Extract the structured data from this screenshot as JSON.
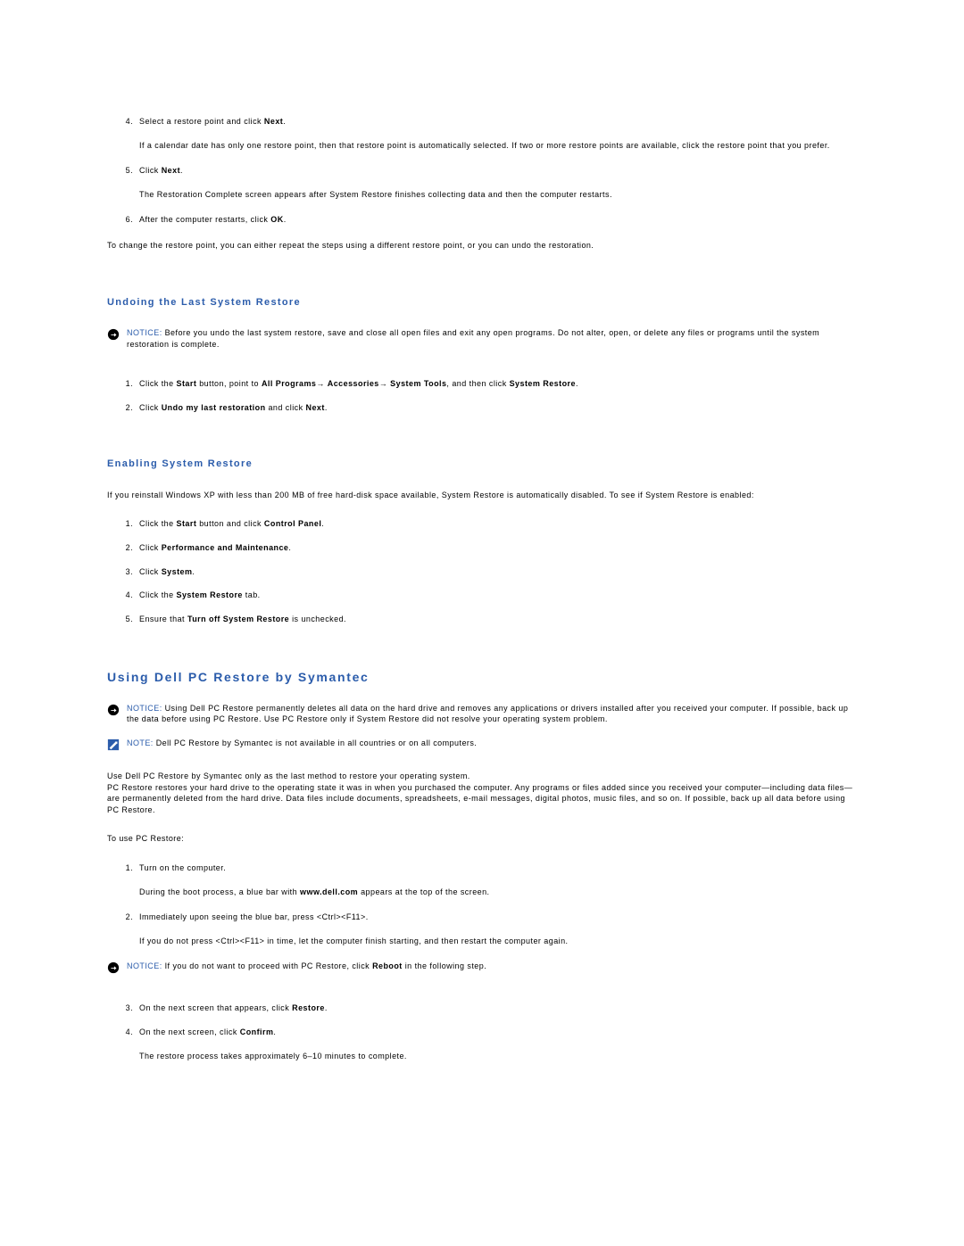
{
  "steps_a": [
    {
      "prefix": "Select a restore point and click ",
      "bold1": "Next",
      "after1": ".",
      "sub": "If a calendar date has only one restore point, then that restore point is automatically selected. If two or more restore points are available, click the restore point that you prefer."
    },
    {
      "prefix": "Click ",
      "bold1": "Next",
      "after1": ".",
      "sub": "The Restoration Complete screen appears after System Restore finishes collecting data and then the computer restarts."
    },
    {
      "prefix": "After the computer restarts, click ",
      "bold1": "OK",
      "after1": "."
    }
  ],
  "para_change": "To change the restore point, you can either repeat the steps using a different restore point, or you can undo the restoration.",
  "subhead_undo": "Undoing the Last System Restore",
  "notice_undo": {
    "label": "NOTICE: ",
    "text": "Before you undo the last system restore, save and close all open files and exit any open programs. Do not alter, open, or delete any files or programs until the system restoration is complete."
  },
  "steps_undo": [
    {
      "p1": "Click the ",
      "b1": "Start",
      "p2": " button, point to ",
      "b2": "All Programs",
      "arr1": "→ ",
      "b3": "Accessories",
      "arr2": "→ ",
      "b4": "System Tools",
      "p3": ", and then click ",
      "b5": "System Restore",
      "p4": "."
    },
    {
      "p1": "Click ",
      "b1": "Undo my last restoration",
      "p2": " and click ",
      "b2": "Next",
      "p3": "."
    }
  ],
  "subhead_enable": "Enabling System Restore",
  "para_enable": "If you reinstall Windows XP with less than 200 MB of free hard-disk space available, System Restore is automatically disabled. To see if System Restore is enabled:",
  "steps_enable": [
    {
      "p1": "Click the ",
      "b1": "Start",
      "p2": " button and click ",
      "b2": "Control Panel",
      "p3": "."
    },
    {
      "p1": "Click ",
      "b1": "Performance and Maintenance",
      "p2": "."
    },
    {
      "p1": "Click ",
      "b1": "System",
      "p2": "."
    },
    {
      "p1": "Click the ",
      "b1": "System Restore",
      "p2": " tab."
    },
    {
      "p1": "Ensure that ",
      "b1": "Turn off System Restore",
      "p2": " is unchecked."
    }
  ],
  "heading_dell": "Using Dell PC Restore by Symantec",
  "notice_dell": {
    "label": "NOTICE: ",
    "text": "Using Dell PC Restore permanently deletes all data on the hard drive and removes any applications or drivers installed after you received your computer. If possible, back up the data before using PC Restore. Use PC Restore only if System Restore did not resolve your operating system problem."
  },
  "note_dell": {
    "label": "NOTE: ",
    "text": "Dell PC Restore by Symantec is not available in all countries or on all computers."
  },
  "para_dell1": "Use Dell PC Restore by Symantec only as the last method to restore your operating system.",
  "para_dell2": "PC Restore restores your hard drive to the operating state it was in when you purchased the computer. Any programs or files added since you received your computer—including data files—are permanently deleted from the hard drive. Data files include documents, spreadsheets, e-mail messages, digital photos, music files, and so on. If possible, back up all data before using PC Restore.",
  "para_dell3": "To use PC Restore:",
  "steps_dell_a": [
    {
      "p1": "Turn on the computer.",
      "sub_pre": "During the boot process, a blue bar with ",
      "sub_b": "www.dell.com",
      "sub_post": " appears at the top of the screen."
    },
    {
      "p1": "Immediately upon seeing the blue bar, press <Ctrl><F11>.",
      "sub": "If you do not press <Ctrl><F11> in time, let the computer finish starting, and then restart the computer again."
    }
  ],
  "notice_reboot": {
    "label": "NOTICE: ",
    "p1": "If you do not want to proceed with PC Restore, click ",
    "b1": "Reboot",
    "p2": " in the following step."
  },
  "steps_dell_b": [
    {
      "p1": "On the next screen that appears, click ",
      "b1": "Restore",
      "p2": "."
    },
    {
      "p1": "On the next screen, click ",
      "b1": "Confirm",
      "p2": ".",
      "sub": "The restore process takes approximately 6–10 minutes to complete."
    }
  ]
}
